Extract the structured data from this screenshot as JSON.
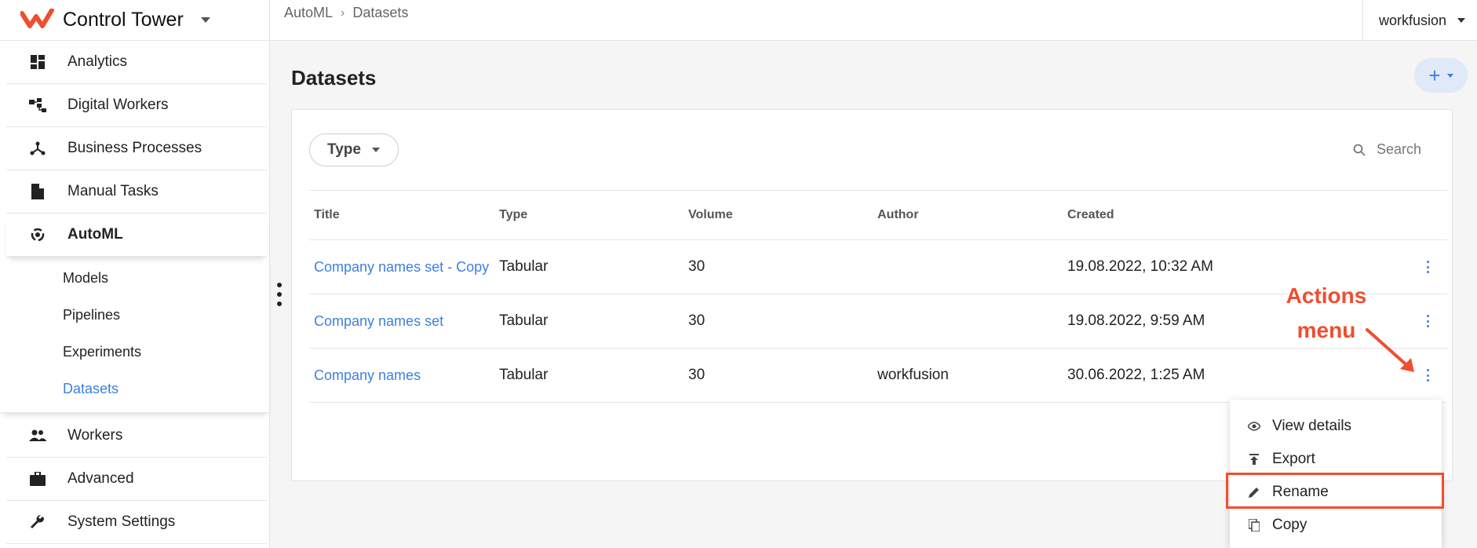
{
  "app": {
    "name": "Control Tower"
  },
  "sidebar": {
    "items": [
      {
        "label": "Analytics",
        "icon": "dashboard-icon"
      },
      {
        "label": "Digital Workers",
        "icon": "workers-tree-icon"
      },
      {
        "label": "Business Processes",
        "icon": "process-icon"
      },
      {
        "label": "Manual Tasks",
        "icon": "document-icon"
      },
      {
        "label": "AutoML",
        "icon": "automl-icon"
      }
    ],
    "automl_sub": [
      {
        "label": "Models"
      },
      {
        "label": "Pipelines"
      },
      {
        "label": "Experiments"
      },
      {
        "label": "Datasets"
      }
    ],
    "bottom_items": [
      {
        "label": "Workers",
        "icon": "people-icon"
      },
      {
        "label": "Advanced",
        "icon": "briefcase-icon"
      },
      {
        "label": "System Settings",
        "icon": "wrench-icon"
      }
    ]
  },
  "header": {
    "breadcrumb": [
      "AutoML",
      "Datasets"
    ],
    "tenant": "workfusion"
  },
  "page": {
    "title": "Datasets",
    "add_label": "+"
  },
  "filters": {
    "type_label": "Type",
    "search_placeholder": "Search"
  },
  "table": {
    "columns": [
      "Title",
      "Type",
      "Volume",
      "Author",
      "Created"
    ],
    "rows": [
      {
        "title": "Company names set - Copy",
        "type": "Tabular",
        "volume": "30",
        "author": "",
        "created": "19.08.2022, 10:32 AM"
      },
      {
        "title": "Company names set",
        "type": "Tabular",
        "volume": "30",
        "author": "",
        "created": "19.08.2022, 9:59 AM"
      },
      {
        "title": "Company names",
        "type": "Tabular",
        "volume": "30",
        "author": "workfusion",
        "created": "30.06.2022, 1:25 AM"
      }
    ]
  },
  "actions_menu": {
    "items": [
      {
        "label": "View details",
        "icon": "eye-icon"
      },
      {
        "label": "Export",
        "icon": "export-icon"
      },
      {
        "label": "Rename",
        "icon": "pencil-icon"
      },
      {
        "label": "Copy",
        "icon": "copy-icon"
      }
    ]
  },
  "annotation": {
    "line1": "Actions",
    "line2": "menu",
    "color": "#f04e30"
  },
  "colors": {
    "accent": "#3d7fe0",
    "highlight": "#f04e30"
  }
}
